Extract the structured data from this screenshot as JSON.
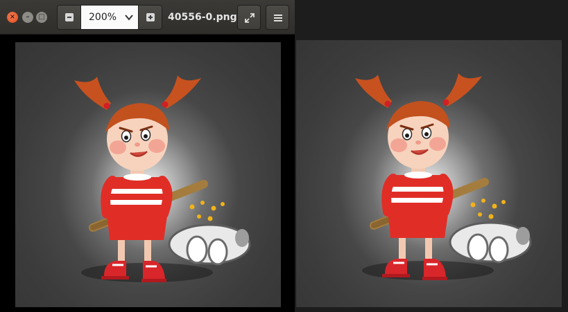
{
  "window": {
    "title": "40556-0.png",
    "zoom_value": "200%"
  },
  "icons": {
    "close": "close-icon",
    "minimize": "minimize-icon",
    "maximize": "maximize-icon",
    "zoom_out": "zoom-out-icon",
    "zoom_in": "zoom-in-icon",
    "dropdown": "chevron-down-icon",
    "fullscreen": "fullscreen-icon",
    "menu": "hamburger-menu-icon"
  },
  "colors": {
    "close_button": "#df4a16",
    "headerbar": "#3b3a37",
    "image_background": "#3c3c3c"
  }
}
